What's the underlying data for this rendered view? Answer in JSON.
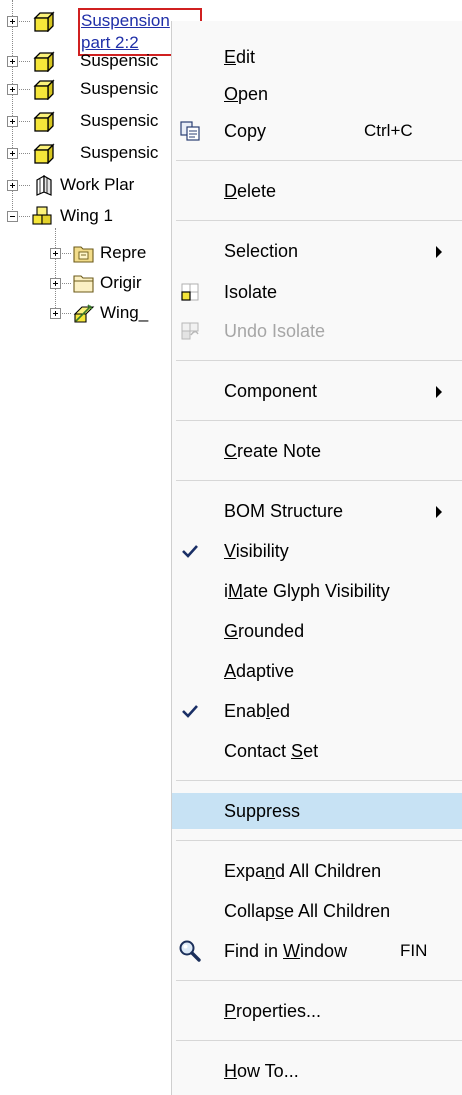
{
  "tree": {
    "items": [
      {
        "label": "Suspension part 2:2",
        "selected": true
      },
      {
        "label": "Suspensic"
      },
      {
        "label": "Suspensic"
      },
      {
        "label": "Suspensic"
      },
      {
        "label": "Suspensic"
      },
      {
        "label": "Work Plar"
      },
      {
        "label": "Wing 1"
      },
      {
        "label": "Repre"
      },
      {
        "label": "Origir"
      },
      {
        "label": "Wing_"
      }
    ]
  },
  "menu": {
    "items": [
      {
        "label": "Edit",
        "mnemonic": "E"
      },
      {
        "label": "Open",
        "mnemonic": "O"
      },
      {
        "label": "Copy",
        "shortcut": "Ctrl+C",
        "icon": "copy-icon"
      },
      {
        "label": "Delete",
        "mnemonic": "D"
      },
      {
        "label": "Selection",
        "submenu": true
      },
      {
        "label": "Isolate",
        "icon": "isolate-icon"
      },
      {
        "label": "Undo Isolate",
        "disabled": true,
        "icon": "undo-isolate-icon"
      },
      {
        "label": "Component",
        "submenu": true
      },
      {
        "label": "Create Note",
        "mnemonic": "C"
      },
      {
        "label": "BOM Structure",
        "submenu": true
      },
      {
        "label": "Visibility",
        "checked": true,
        "mnemonic": "V"
      },
      {
        "label": "iMate Glyph Visibility",
        "mnemonic": "M"
      },
      {
        "label": "Grounded",
        "mnemonic": "G"
      },
      {
        "label": "Adaptive",
        "mnemonic": "A"
      },
      {
        "label": "Enabled",
        "checked": true,
        "mnemonic": "l"
      },
      {
        "label": "Contact Set",
        "mnemonic": "S"
      },
      {
        "label": "Suppress",
        "highlighted": true
      },
      {
        "label": "Expand All Children",
        "mnemonic": "n"
      },
      {
        "label": "Collapse All Children",
        "mnemonic": "s"
      },
      {
        "label": "Find in Window",
        "shortcut": "FIN",
        "icon": "magnifier-icon",
        "mnemonic": "W"
      },
      {
        "label": "Properties...",
        "mnemonic": "P"
      },
      {
        "label": "How To...",
        "mnemonic": "H"
      }
    ]
  },
  "colors": {
    "highlight": "#c7e2f4",
    "selection_outline": "#d02020",
    "part_yellow": "#f5e63a"
  }
}
